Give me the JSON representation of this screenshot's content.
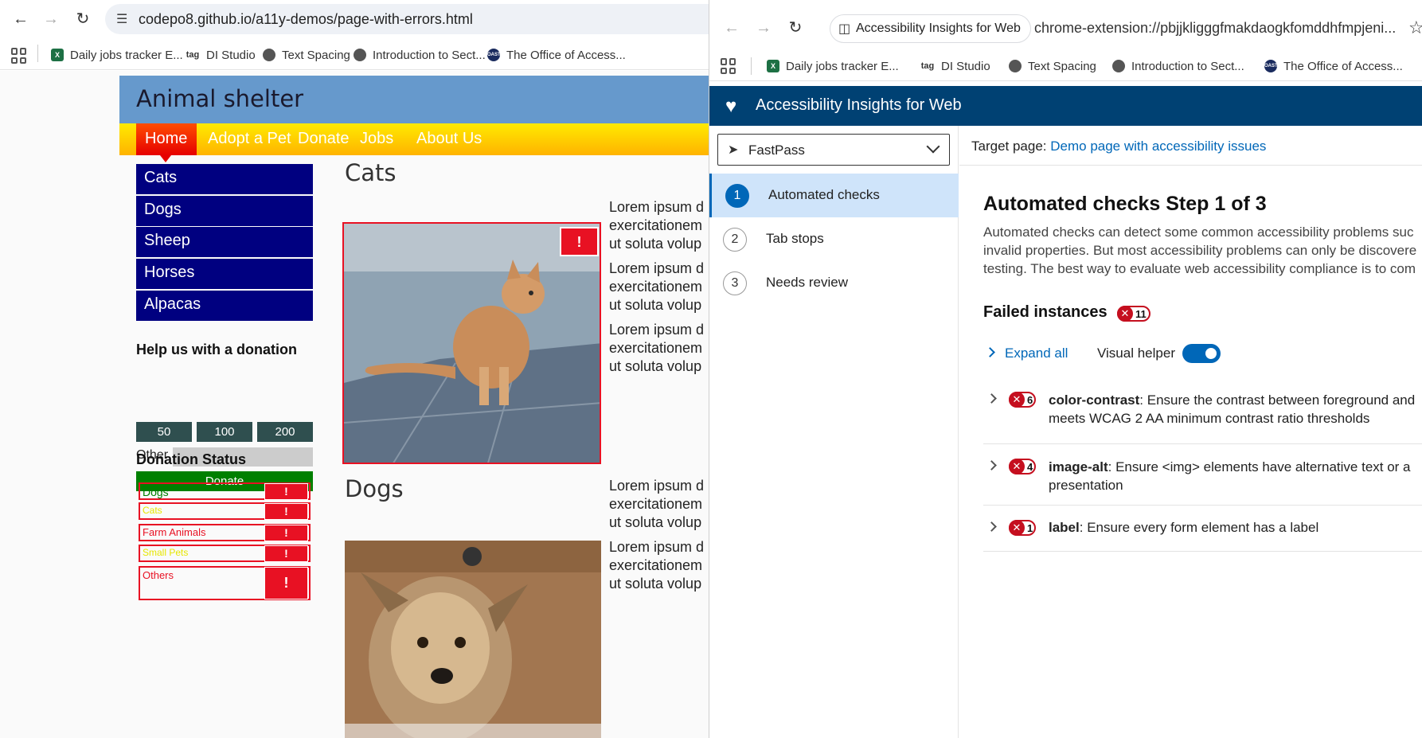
{
  "left_browser": {
    "url": "codepo8.github.io/a11y-demos/page-with-errors.html",
    "bookmarks": [
      {
        "label": "Daily jobs tracker E...",
        "icon": "excel-icon"
      },
      {
        "label": "DI Studio",
        "icon": "tag-icon"
      },
      {
        "label": "Text Spacing",
        "icon": "globe-icon"
      },
      {
        "label": "Introduction to Sect...",
        "icon": "globe-icon"
      },
      {
        "label": "The Office of Access...",
        "icon": "oast-icon"
      }
    ]
  },
  "site": {
    "title": "Animal shelter",
    "nav": [
      "Home",
      "Adopt a Pet",
      "Donate",
      "Jobs",
      "About Us"
    ],
    "sidebar": [
      "Cats",
      "Dogs",
      "Sheep",
      "Horses",
      "Alpacas"
    ],
    "donation_heading": "Help us with a donation",
    "amounts": [
      "50",
      "100",
      "200"
    ],
    "other_label": "Other",
    "donate_label": "Donate",
    "status_heading": "Donation Status",
    "status_items": [
      "Dogs",
      "Cats",
      "Farm Animals",
      "Small Pets",
      "Others"
    ],
    "error_flag": "!",
    "sections": [
      "Cats",
      "Dogs"
    ],
    "lorem": [
      "Lorem ipsum d",
      "exercitationem",
      "ut soluta volup"
    ],
    "colors": {
      "header": "#6699cc",
      "sidebar": "#000080",
      "error": "#e81123",
      "donate": "#008000"
    }
  },
  "right_browser": {
    "extension_chip": "Accessibility Insights for Web",
    "url": "chrome-extension://pbjjkligggfmakdaogkfomddhfmpjeni...",
    "bookmarks": [
      {
        "label": "Daily jobs tracker E...",
        "icon": "excel-icon"
      },
      {
        "label": "DI Studio",
        "icon": "tag-icon"
      },
      {
        "label": "Text Spacing",
        "icon": "globe-icon"
      },
      {
        "label": "Introduction to Sect...",
        "icon": "globe-icon"
      },
      {
        "label": "The Office of Access...",
        "icon": "oast-icon"
      }
    ]
  },
  "insights": {
    "app_title": "Accessibility Insights for Web",
    "mode": "FastPass",
    "steps": [
      {
        "num": "1",
        "label": "Automated checks"
      },
      {
        "num": "2",
        "label": "Tab stops"
      },
      {
        "num": "3",
        "label": "Needs review"
      }
    ],
    "target_label": "Target page:",
    "target_link": "Demo page with accessibility issues",
    "heading": "Automated checks Step 1 of 3",
    "description": [
      "Automated checks can detect some common accessibility problems suc",
      "invalid properties. But most accessibility problems can only be discovere",
      "testing. The best way to evaluate web accessibility compliance is to com"
    ],
    "failed_label": "Failed instances",
    "failed_count": "11",
    "expand_all": "Expand all",
    "visual_helper": "Visual helper",
    "visual_helper_on": true,
    "rules": [
      {
        "id": "color-contrast",
        "count": "6",
        "text": ": Ensure the contrast between foreground and",
        "text2": "meets WCAG 2 AA minimum contrast ratio thresholds"
      },
      {
        "id": "image-alt",
        "count": "4",
        "text": ": Ensure <img> elements have alternative text or a",
        "text2": "presentation"
      },
      {
        "id": "label",
        "count": "1",
        "text": ": Ensure every form element has a label",
        "text2": ""
      }
    ],
    "colors": {
      "header": "#004173",
      "accent": "#0067b8",
      "error": "#c50f1f"
    }
  }
}
